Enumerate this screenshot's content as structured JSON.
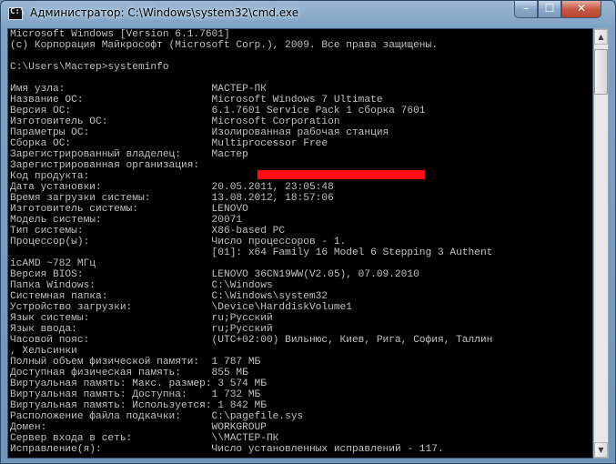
{
  "window": {
    "title": "Администратор: C:\\Windows\\system32\\cmd.exe",
    "icon_name": "cmd-icon",
    "icon_glyph": "C:\\",
    "min_glyph": "–",
    "max_glyph": "☐",
    "close_glyph": "✕"
  },
  "console": {
    "lines": [
      "Microsoft Windows [Version 6.1.7601]",
      "(c) Корпорация Майкрософт (Microsoft Corp.), 2009. Все права защищены.",
      "",
      "C:\\Users\\Мастер>systeminfo",
      "",
      "Имя узла:                        МАСТЕР-ПК",
      "Название ОС:                     Microsoft Windows 7 Ultimate",
      "Версия ОС:                       6.1.7601 Service Pack 1 сборка 7601",
      "Изготовитель ОС:                 Microsoft Corporation",
      "Параметры ОС:                    Изолированная рабочая станция",
      "Сборка ОС:                       Multiprocessor Free",
      "Зарегистрированный владелец:     Мастер",
      "Зарегистрированная организация:",
      "Код продукта:",
      "Дата установки:                  20.05.2011, 23:05:48",
      "Время загрузки системы:          13.08.2012, 18:57:06",
      "Изготовитель системы:            LENOVO",
      "Модель системы:                  20071",
      "Тип системы:                     X86-based PC",
      "Процессор(ы):                    Число процессоров - 1.",
      "                                 [01]: x64 Family 16 Model 6 Stepping 3 Authent",
      "icAMD ~782 МГц",
      "Версия BIOS:                     LENOVO 36CN19WW(V2.05), 07.09.2010",
      "Папка Windows:                   C:\\Windows",
      "Системная папка:                 C:\\Windows\\system32",
      "Устройство загрузки:             \\Device\\HarddiskVolume1",
      "Язык системы:                    ru;Русский",
      "Язык ввода:                      ru;Русский",
      "Часовой пояс:                    (UTC+02:00) Вильнюс, Киев, Рига, София, Таллин",
      ", Хельсинки",
      "Полный объем физической памяти:  1 787 МБ",
      "Доступная физическая память:     855 МБ",
      "Виртуальная память: Макс. размер: 3 574 МБ",
      "Виртуальная память: Доступна:    1 732 МБ",
      "Виртуальная память: Используется: 1 842 МБ",
      "Расположение файла подкачки:     C:\\pagefile.sys",
      "Домен:                           WORKGROUP",
      "Сервер входа в сеть:             \\\\МАСТЕР-ПК",
      "Исправление(я):                  Число установленных исправлений - 117."
    ]
  },
  "colors": {
    "console_bg": "#000000",
    "console_fg": "#c0c0c0",
    "redaction": "#ff1010"
  },
  "scrollbar": {
    "up_glyph": "▲",
    "down_glyph": "▼"
  }
}
